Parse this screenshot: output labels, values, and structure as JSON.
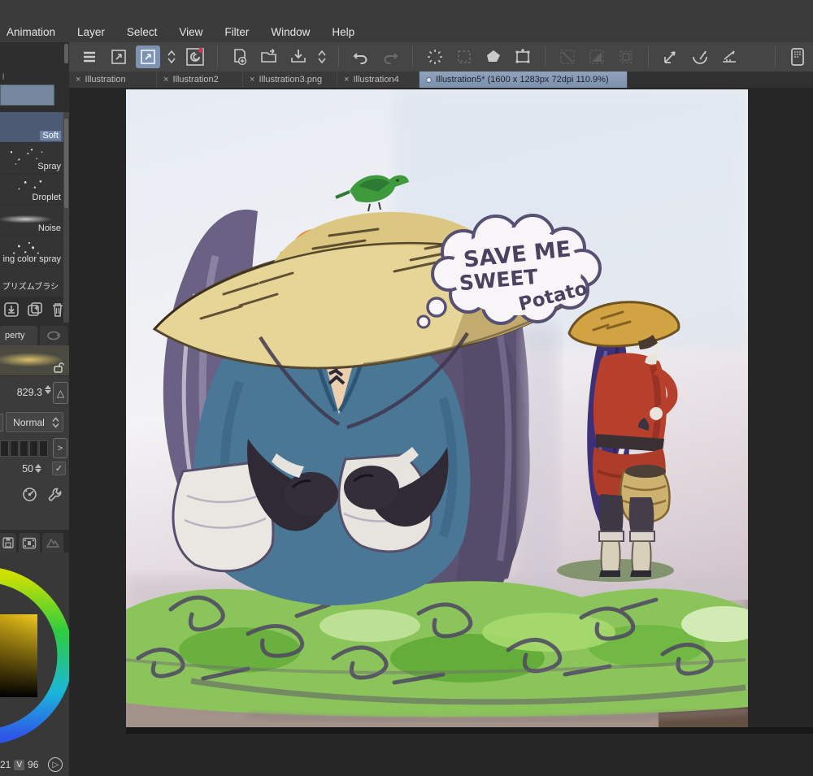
{
  "menubar": {
    "items": [
      "Animation",
      "Layer",
      "Select",
      "View",
      "Filter",
      "Window",
      "Help"
    ]
  },
  "toolbar": {
    "icons": [
      "main-menu",
      "scale-window",
      "scale-window-active",
      "toolbar-chevron",
      "clip-studio",
      "new-file",
      "open-file",
      "save-file",
      "file-chevron",
      "undo",
      "redo",
      "deselect",
      "reselect",
      "fill",
      "frame",
      "line-disabled",
      "gradient-disabled",
      "selection-disabled",
      "snap-ruler",
      "snap-curve",
      "snap-special",
      "tablet-mode"
    ],
    "accent_color": "#7e93b2"
  },
  "tabs": [
    {
      "close": "×",
      "label": "Illustration",
      "active": false
    },
    {
      "close": "×",
      "label": "Illustration2",
      "active": false
    },
    {
      "close": "×",
      "label": "Illustration3.png",
      "active": false
    },
    {
      "close": "×",
      "label": "Illustration4",
      "active": false
    },
    {
      "dot": "•",
      "label": "Illustration5* (1600 x 1283px 72dpi 110.9%)",
      "active": true
    }
  ],
  "brush_panel": {
    "caption": "l",
    "swatch_color": "#76889f",
    "brushes": [
      {
        "label": "Soft",
        "selected": true
      },
      {
        "label": "Spray",
        "selected": false
      },
      {
        "label": "Droplet",
        "selected": false
      },
      {
        "label": "Noise",
        "selected": false
      },
      {
        "label": "ing color spray",
        "selected": false
      },
      {
        "label": "プリズムブラシ",
        "selected": false
      }
    ],
    "actions": [
      "import-brush",
      "duplicate-brush",
      "delete-brush"
    ]
  },
  "tool_property": {
    "tab_label": "perty",
    "size_value": "829.3",
    "size_unit_button": "△",
    "blend_mode": "Normal",
    "expand_button": ">",
    "opacity_value": "50",
    "checkmark": "✓",
    "icons": [
      "brush-preview",
      "unlock",
      "gauge",
      "wrench"
    ]
  },
  "palette_tabs": {
    "icons": [
      "color-history",
      "film",
      "mountain-disabled"
    ]
  },
  "color_panel": {
    "value_left": "21",
    "channel": "V",
    "value_right": "96",
    "play_glyph": "▷",
    "sv_top_color": "#f0c81e",
    "ring_colors": [
      "#cfe000",
      "#2ecc40",
      "#1ab8d8",
      "#2f55e8"
    ]
  },
  "canvas": {
    "speech": {
      "line1": "SAVE ME",
      "line2": "SWEET",
      "line3": "Potato"
    }
  }
}
